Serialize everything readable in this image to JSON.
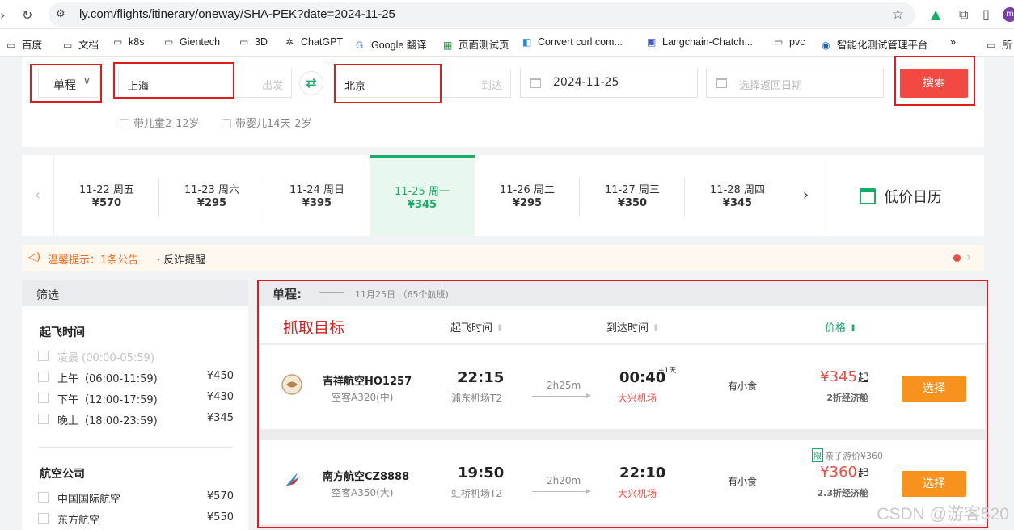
{
  "browser": {
    "url": "ly.com/flights/itinerary/oneway/SHA-PEK?date=2024-11-25",
    "profile_initial": "m",
    "bookmarks": [
      {
        "label": "百度",
        "icon": "folder-icon"
      },
      {
        "label": "文档",
        "icon": "folder-icon"
      },
      {
        "label": "k8s",
        "icon": "folder-icon"
      },
      {
        "label": "Gientech",
        "icon": "folder-icon"
      },
      {
        "label": "3D",
        "icon": "folder-icon"
      },
      {
        "label": "ChatGPT",
        "icon": "chatgpt-icon"
      },
      {
        "label": "Google 翻译",
        "icon": "translate-icon"
      },
      {
        "label": "页面测试页",
        "icon": "page-icon"
      },
      {
        "label": "Convert curl com...",
        "icon": "convert-icon"
      },
      {
        "label": "Langchain-Chatch...",
        "icon": "chat-icon"
      },
      {
        "label": "pvc",
        "icon": "folder-icon"
      },
      {
        "label": "智能化测试管理平台",
        "icon": "platform-icon"
      },
      {
        "label": "»",
        "icon": ""
      },
      {
        "label": "所",
        "icon": "folder-icon"
      }
    ]
  },
  "search": {
    "trip_type": "单程",
    "from_city": "上海",
    "from_hint": "出发",
    "to_city": "北京",
    "to_hint": "到达",
    "depart_date": "2024-11-25",
    "return_placeholder": "选择返回日期",
    "search_label": "搜索",
    "child_option": "带儿童2-12岁",
    "infant_option": "带婴儿14天-2岁"
  },
  "date_strip": {
    "days": [
      {
        "date": "11-22 周五",
        "price": "¥570"
      },
      {
        "date": "11-23 周六",
        "price": "¥295"
      },
      {
        "date": "11-24 周日",
        "price": "¥395"
      },
      {
        "date": "11-25 周一",
        "price": "¥345"
      },
      {
        "date": "11-26 周二",
        "price": "¥295"
      },
      {
        "date": "11-27 周三",
        "price": "¥350"
      },
      {
        "date": "11-28 周四",
        "price": "¥345"
      }
    ],
    "active_index": 3,
    "low_price_calendar": "低价日历"
  },
  "notice": {
    "tip": "温馨提示：1条公告",
    "fraud": "· 反诈提醒"
  },
  "filter": {
    "header": "筛选",
    "departure_title": "起飞时间",
    "departure_options": [
      {
        "label": "凌晨 (00:00-05:59)",
        "price": "",
        "disabled": true
      },
      {
        "label": "上午（06:00-11:59)",
        "price": "¥450",
        "disabled": false
      },
      {
        "label": "下午（12:00-17:59)",
        "price": "¥430",
        "disabled": false
      },
      {
        "label": "晚上（18:00-23:59)",
        "price": "¥345",
        "disabled": false
      }
    ],
    "airline_title": "航空公司",
    "airline_options": [
      {
        "label": "中国国际航空",
        "price": "¥570"
      },
      {
        "label": "东方航空",
        "price": "¥550"
      }
    ]
  },
  "results": {
    "title": "单程:",
    "date_info": "11月25日 （65个航班)",
    "annotation": "抓取目标",
    "col_depart": "起飞时间",
    "col_arrive": "到达时间",
    "col_price": "价格",
    "flights": [
      {
        "airline_flight": "吉祥航空HO1257",
        "aircraft": "空客A320(中)",
        "dep_time": "22:15",
        "dep_airport": "浦东机场T2",
        "duration": "2h25m",
        "arr_time": "00:40",
        "next_day": "+1天",
        "arr_airport": "大兴机场",
        "meal": "有小食",
        "promo_tag": "",
        "promo_text": "",
        "price": "¥345",
        "price_suffix": "起",
        "cabin": "2折经济舱",
        "select_label": "选择",
        "logo": "juneyao-logo-icon"
      },
      {
        "airline_flight": "南方航空CZ8888",
        "aircraft": "空客A350(大)",
        "dep_time": "19:50",
        "dep_airport": "虹桥机场T2",
        "duration": "2h20m",
        "arr_time": "22:10",
        "next_day": "",
        "arr_airport": "大兴机场",
        "meal": "有小食",
        "promo_tag": "限",
        "promo_text": "亲子游价¥360",
        "price": "¥360",
        "price_suffix": "起",
        "cabin": "2.3折经济舱",
        "select_label": "选择",
        "logo": "china-southern-logo-icon"
      }
    ]
  },
  "watermark": "CSDN @游客520",
  "colors": {
    "brand_green": "#1aad68",
    "price_red": "#f24a43",
    "select_orange": "#f7921e",
    "annotation_red": "#e21a1a"
  }
}
